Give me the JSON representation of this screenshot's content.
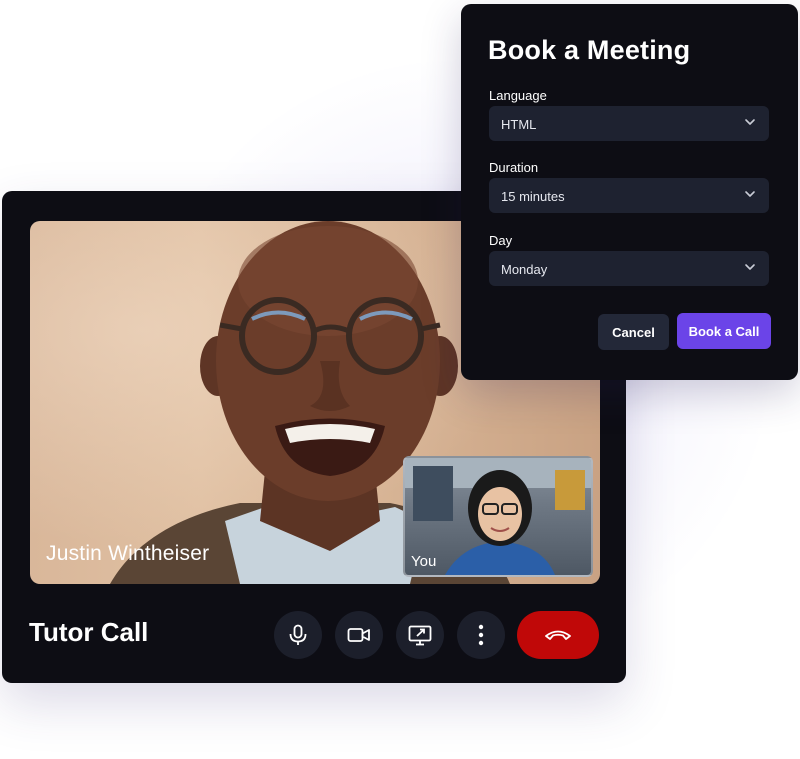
{
  "call": {
    "title": "Tutor Call",
    "participant_name": "Justin Wintheiser",
    "self_label": "You",
    "controls": [
      {
        "icon": "microphone-icon",
        "label": "Microphone"
      },
      {
        "icon": "camera-icon",
        "label": "Camera"
      },
      {
        "icon": "screen-share-icon",
        "label": "Share screen"
      },
      {
        "icon": "more-vertical-icon",
        "label": "More"
      },
      {
        "icon": "end-call-icon",
        "label": "End call"
      }
    ],
    "end_call_color": "#c00808"
  },
  "booking": {
    "title": "Book a Meeting",
    "fields": {
      "language": {
        "label": "Language",
        "value": "HTML"
      },
      "duration": {
        "label": "Duration",
        "value": "15 minutes"
      },
      "day": {
        "label": "Day",
        "value": "Monday"
      }
    },
    "cancel_label": "Cancel",
    "book_label": "Book a Call",
    "accent_color": "#6b44e8"
  }
}
